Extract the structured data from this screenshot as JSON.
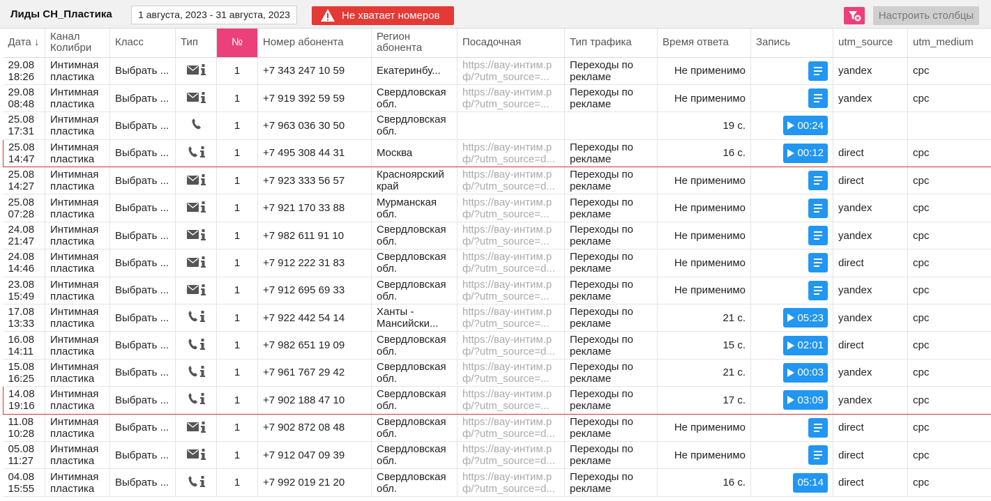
{
  "header": {
    "title": "Лиды СН_Пластика",
    "date_range": "1 августа, 2023 - 31 августа, 2023",
    "alert": "Не хватает номеров",
    "configure_columns": "Настроить столбцы"
  },
  "columns": {
    "date": "Дата ↓",
    "channel": "Канал Колибри",
    "class": "Класс",
    "type": "Тип",
    "num": "№",
    "phone": "Номер абонента",
    "region": "Регион абонента",
    "landing": "Посадочная",
    "traffic": "Тип трафика",
    "response": "Время ответа",
    "record": "Запись",
    "utm_source": "utm_source",
    "utm_medium": "utm_medium"
  },
  "rows": [
    {
      "date": "29.08",
      "time": "18:26",
      "channel": "Интимная пластика",
      "class": "Выбрать ...",
      "type": "mail",
      "num": "1",
      "phone": "+7 343 247 10 59",
      "region": "Екатеринбу...",
      "landing": "https://вау-интим.рф/?utm_source=...",
      "traffic": "Переходы по рекламе",
      "response": "Не применимо",
      "record": "doc",
      "record_time": "",
      "utm_source": "yandex",
      "utm_medium": "cpc",
      "highlight": false
    },
    {
      "date": "29.08",
      "time": "08:48",
      "channel": "Интимная пластика",
      "class": "Выбрать ...",
      "type": "mail",
      "num": "1",
      "phone": "+7 919 392 59 59",
      "region": "Свердловская обл.",
      "landing": "https://вау-интим.рф/?utm_source=...",
      "traffic": "Переходы по рекламе",
      "response": "Не применимо",
      "record": "doc",
      "record_time": "",
      "utm_source": "yandex",
      "utm_medium": "cpc",
      "highlight": false
    },
    {
      "date": "25.08",
      "time": "17:31",
      "channel": "Интимная пластика",
      "class": "Выбрать ...",
      "type": "phone-only",
      "num": "1",
      "phone": "+7 963 036 30 50",
      "region": "Свердловская обл.",
      "landing": "",
      "traffic": "",
      "response": "19 с.",
      "record": "play",
      "record_time": "00:24",
      "utm_source": "",
      "utm_medium": "",
      "highlight": false
    },
    {
      "date": "25.08",
      "time": "14:47",
      "channel": "Интимная пластика",
      "class": "Выбрать ...",
      "type": "phone",
      "num": "1",
      "phone": "+7 495 308 44 31",
      "region": "Москва",
      "landing": "https://вау-интим.рф/?utm_source=d...",
      "traffic": "Переходы по рекламе",
      "response": "16 с.",
      "record": "play",
      "record_time": "00:12",
      "utm_source": "direct",
      "utm_medium": "cpc",
      "highlight": true
    },
    {
      "date": "25.08",
      "time": "14:27",
      "channel": "Интимная пластика",
      "class": "Выбрать ...",
      "type": "mail",
      "num": "1",
      "phone": "+7 923 333 56 57",
      "region": "Красноярский край",
      "landing": "https://вау-интим.рф/?utm_source=d...",
      "traffic": "Переходы по рекламе",
      "response": "Не применимо",
      "record": "doc",
      "record_time": "",
      "utm_source": "direct",
      "utm_medium": "cpc",
      "highlight": false
    },
    {
      "date": "25.08",
      "time": "07:28",
      "channel": "Интимная пластика",
      "class": "Выбрать ...",
      "type": "mail",
      "num": "1",
      "phone": "+7 921 170 33 88",
      "region": "Мурманская обл.",
      "landing": "https://вау-интим.рф/?utm_source=...",
      "traffic": "Переходы по рекламе",
      "response": "Не применимо",
      "record": "doc",
      "record_time": "",
      "utm_source": "yandex",
      "utm_medium": "cpc",
      "highlight": false
    },
    {
      "date": "24.08",
      "time": "21:47",
      "channel": "Интимная пластика",
      "class": "Выбрать ...",
      "type": "mail",
      "num": "1",
      "phone": "+7 982 611 91 10",
      "region": "Свердловская обл.",
      "landing": "https://вау-интим.рф/?utm_source=...",
      "traffic": "Переходы по рекламе",
      "response": "Не применимо",
      "record": "doc",
      "record_time": "",
      "utm_source": "yandex",
      "utm_medium": "cpc",
      "highlight": false
    },
    {
      "date": "24.08",
      "time": "14:46",
      "channel": "Интимная пластика",
      "class": "Выбрать ...",
      "type": "mail",
      "num": "1",
      "phone": "+7 912 222 31 83",
      "region": "Свердловская обл.",
      "landing": "https://вау-интим.рф/?utm_source=d...",
      "traffic": "Переходы по рекламе",
      "response": "Не применимо",
      "record": "doc",
      "record_time": "",
      "utm_source": "direct",
      "utm_medium": "cpc",
      "highlight": false
    },
    {
      "date": "23.08",
      "time": "15:49",
      "channel": "Интимная пластика",
      "class": "Выбрать ...",
      "type": "mail",
      "num": "1",
      "phone": "+7 912 695 69 33",
      "region": "Свердловская обл.",
      "landing": "https://вау-интим.рф/?utm_source=...",
      "traffic": "Переходы по рекламе",
      "response": "Не применимо",
      "record": "doc",
      "record_time": "",
      "utm_source": "yandex",
      "utm_medium": "cpc",
      "highlight": false
    },
    {
      "date": "17.08",
      "time": "13:33",
      "channel": "Интимная пластика",
      "class": "Выбрать ...",
      "type": "phone",
      "num": "1",
      "phone": "+7 922 442 54 14",
      "region": "Ханты - Мансийски...",
      "landing": "https://вау-интим.рф/?utm_source=...",
      "traffic": "Переходы по рекламе",
      "response": "21 с.",
      "record": "play",
      "record_time": "05:23",
      "utm_source": "yandex",
      "utm_medium": "cpc",
      "highlight": false
    },
    {
      "date": "16.08",
      "time": "14:11",
      "channel": "Интимная пластика",
      "class": "Выбрать ...",
      "type": "phone",
      "num": "1",
      "phone": "+7 982 651 19 09",
      "region": "Свердловская обл.",
      "landing": "https://вау-интим.рф/?utm_source=d...",
      "traffic": "Переходы по рекламе",
      "response": "15 с.",
      "record": "play",
      "record_time": "02:01",
      "utm_source": "direct",
      "utm_medium": "cpc",
      "highlight": false
    },
    {
      "date": "15.08",
      "time": "16:25",
      "channel": "Интимная пластика",
      "class": "Выбрать ...",
      "type": "phone",
      "num": "1",
      "phone": "+7 961 767 29 42",
      "region": "Свердловская обл.",
      "landing": "https://вау-интим.рф/?utm_source=...",
      "traffic": "Переходы по рекламе",
      "response": "21 с.",
      "record": "play",
      "record_time": "00:03",
      "utm_source": "yandex",
      "utm_medium": "cpc",
      "highlight": false
    },
    {
      "date": "14.08",
      "time": "19:16",
      "channel": "Интимная пластика",
      "class": "Выбрать ...",
      "type": "phone",
      "num": "1",
      "phone": "+7 902 188 47 10",
      "region": "Свердловская обл.",
      "landing": "https://вау-интим.рф/?utm_source=...",
      "traffic": "Переходы по рекламе",
      "response": "17 с.",
      "record": "play",
      "record_time": "03:09",
      "utm_source": "yandex",
      "utm_medium": "cpc",
      "highlight": true
    },
    {
      "date": "11.08",
      "time": "10:28",
      "channel": "Интимная пластика",
      "class": "Выбрать ...",
      "type": "mail",
      "num": "1",
      "phone": "+7 902 872 08 48",
      "region": "Свердловская обл.",
      "landing": "https://вау-интим.рф/?utm_source=d...",
      "traffic": "Переходы по рекламе",
      "response": "Не применимо",
      "record": "doc",
      "record_time": "",
      "utm_source": "direct",
      "utm_medium": "cpc",
      "highlight": false
    },
    {
      "date": "05.08",
      "time": "11:27",
      "channel": "Интимная пластика",
      "class": "Выбрать ...",
      "type": "mail",
      "num": "1",
      "phone": "+7 912 047 09 39",
      "region": "Свердловская обл.",
      "landing": "https://вау-интим.рф/?utm_source=d...",
      "traffic": "Переходы по рекламе",
      "response": "Не применимо",
      "record": "doc",
      "record_time": "",
      "utm_source": "direct",
      "utm_medium": "cpc",
      "highlight": false
    },
    {
      "date": "04.08",
      "time": "15:55",
      "channel": "Интимная пластика",
      "class": "Выбрать ...",
      "type": "phone",
      "num": "1",
      "phone": "+7 992 019 21 20",
      "region": "Свердловская обл.",
      "landing": "https://вау-интим.рф/?utm_source=d...",
      "traffic": "Переходы по рекламе",
      "response": "16 с.",
      "record": "time",
      "record_time": "05:14",
      "utm_source": "direct",
      "utm_medium": "cpc",
      "highlight": false
    }
  ],
  "colors": {
    "accent": "#2196f3",
    "pink": "#ec407a",
    "alert": "#e53935",
    "highlight_border": "#d32f2f"
  }
}
